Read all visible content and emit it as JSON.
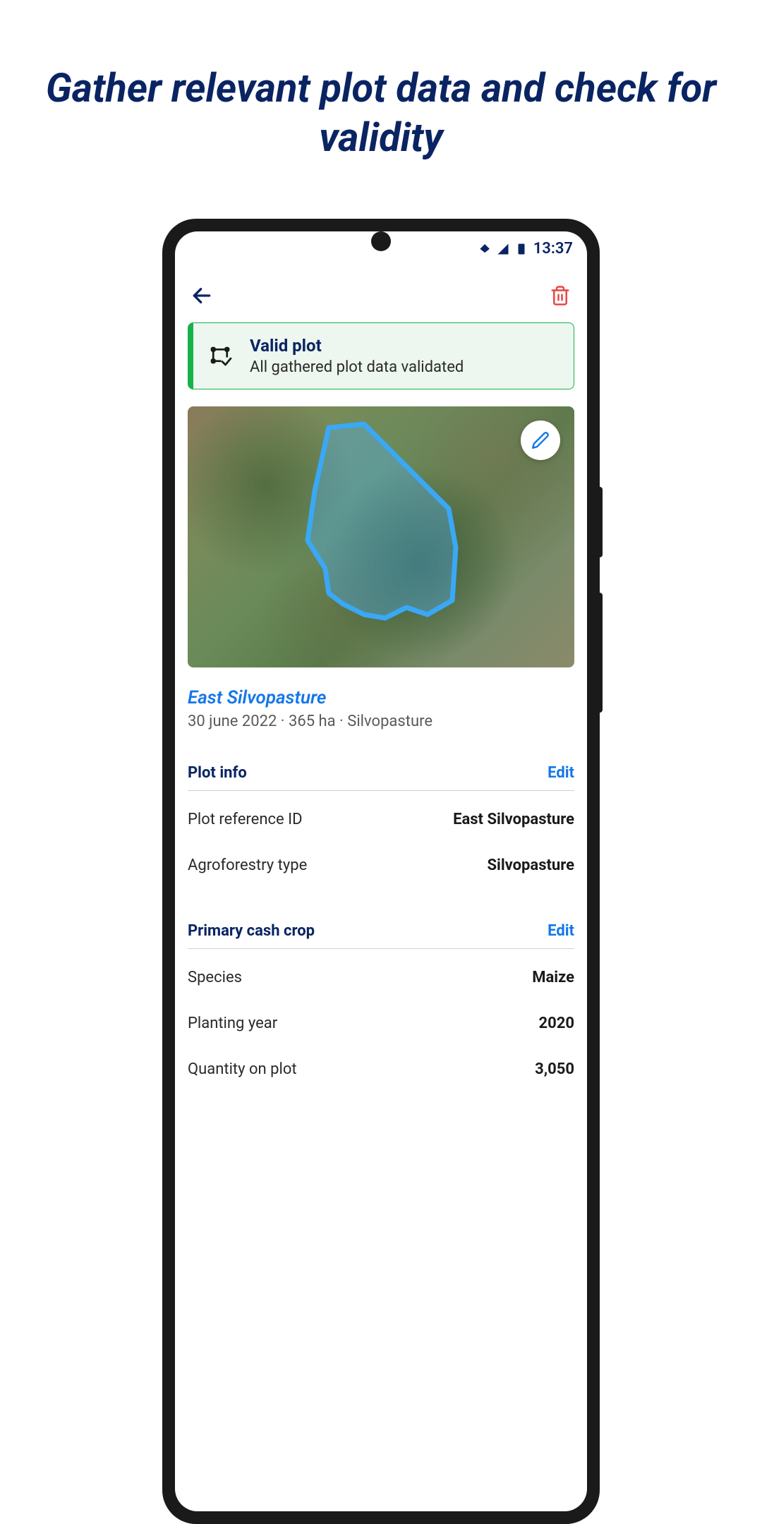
{
  "marketing": {
    "headline": "Gather relevant plot data and check for validity"
  },
  "statusBar": {
    "time": "13:37"
  },
  "validation": {
    "title": "Valid plot",
    "subtitle": "All gathered plot data validated"
  },
  "plot": {
    "title": "East Silvopasture",
    "meta": "30 june 2022  ·  365 ha  ·  Silvopasture"
  },
  "sections": {
    "plotInfo": {
      "title": "Plot info",
      "editLabel": "Edit",
      "rows": [
        {
          "label": "Plot reference ID",
          "value": "East Silvopasture"
        },
        {
          "label": "Agroforestry type",
          "value": "Silvopasture"
        }
      ]
    },
    "primaryCrop": {
      "title": "Primary cash crop",
      "editLabel": "Edit",
      "rows": [
        {
          "label": "Species",
          "value": "Maize"
        },
        {
          "label": "Planting year",
          "value": "2020"
        },
        {
          "label": "Quantity on plot",
          "value": "3,050"
        }
      ]
    }
  }
}
